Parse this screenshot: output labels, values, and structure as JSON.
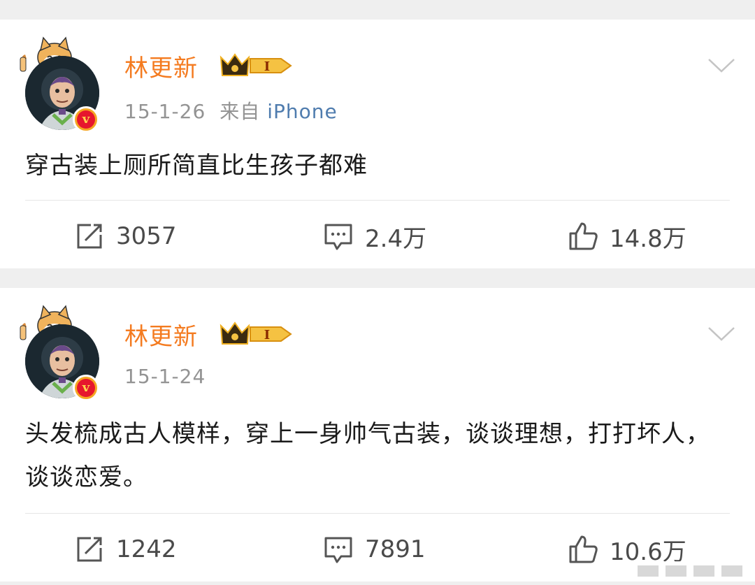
{
  "colors": {
    "username": "#f47b20",
    "source_link": "#4f7cae",
    "meta_gray": "#939393",
    "text": "#1a1a1a",
    "background": "#efefef",
    "verified_badge": "#e6162d"
  },
  "posts": [
    {
      "username": "林更新",
      "badge_icon": "crown-level-badge",
      "badge_level": "I",
      "date": "15-1-26",
      "source_label": "来自",
      "source": "iPhone",
      "content": "穿古装上厕所简直比生孩子都难",
      "reposts": "3057",
      "comments": "2.4万",
      "likes": "14.8万"
    },
    {
      "username": "林更新",
      "badge_icon": "crown-level-badge",
      "badge_level": "I",
      "date": "15-1-24",
      "content": "头发梳成古人模样，穿上一身帅气古装，谈谈理想，打打坏人，谈谈恋爱。",
      "reposts": "1242",
      "comments": "7891",
      "likes": "10.6万"
    }
  ]
}
